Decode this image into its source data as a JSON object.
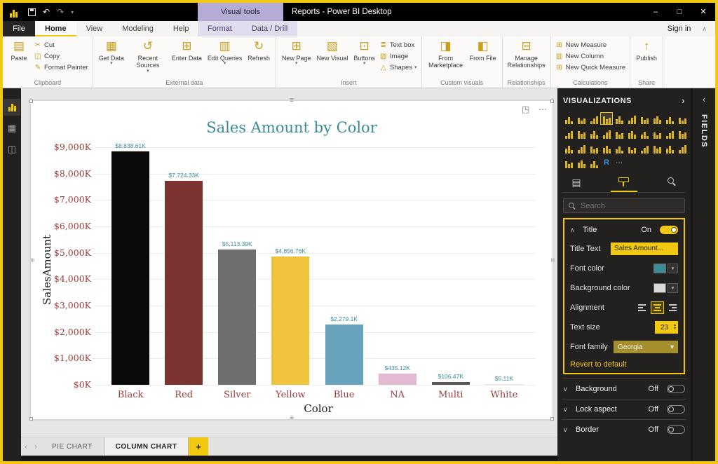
{
  "window": {
    "title": "Reports - Power BI Desktop",
    "undo_glyph": "↶",
    "redo_glyph": "↷",
    "controls": {
      "minimize": "–",
      "maximize": "□",
      "close": "✕"
    }
  },
  "icons": {
    "dropdown": "▾",
    "collapse_ribbon": "∧",
    "pane_collapse_right": "›",
    "pane_collapse_left": "‹",
    "page_back": "‹",
    "page_forward": "›",
    "focus_mode": "◳",
    "more_options": "⋯",
    "drag_handle": "≡"
  },
  "contextual": {
    "group_label": "Visual tools",
    "tabs": [
      "Format",
      "Data / Drill"
    ]
  },
  "ribbon_tabs": [
    "File",
    "Home",
    "View",
    "Modeling",
    "Help"
  ],
  "active_tab": "Home",
  "sign_in": "Sign in",
  "ribbon_groups": [
    {
      "label": "Clipboard",
      "items": [
        {
          "label": "Paste",
          "size": "big",
          "icon": "clipboard-paste",
          "glyph": "▤"
        },
        {
          "label": "Cut",
          "size": "small",
          "icon": "scissors",
          "glyph": "✂"
        },
        {
          "label": "Copy",
          "size": "small",
          "icon": "copy",
          "glyph": "◫"
        },
        {
          "label": "Format Painter",
          "size": "small",
          "icon": "format-painter",
          "glyph": "✎"
        }
      ]
    },
    {
      "label": "External data",
      "items": [
        {
          "label": "Get Data",
          "size": "big",
          "icon": "get-data",
          "glyph": "▦",
          "arrow": true
        },
        {
          "label": "Recent Sources",
          "size": "big",
          "icon": "recent-sources",
          "glyph": "↺",
          "arrow": true
        },
        {
          "label": "Enter Data",
          "size": "big",
          "icon": "enter-data",
          "glyph": "⊞"
        },
        {
          "label": "Edit Queries",
          "size": "big",
          "icon": "edit-queries",
          "glyph": "▥",
          "arrow": true
        },
        {
          "label": "Refresh",
          "size": "big",
          "icon": "refresh",
          "glyph": "↻"
        }
      ]
    },
    {
      "label": "Insert",
      "items": [
        {
          "label": "New Page",
          "size": "big",
          "icon": "new-page",
          "glyph": "⊞",
          "arrow": true
        },
        {
          "label": "New Visual",
          "size": "big",
          "icon": "new-visual",
          "glyph": "▧"
        },
        {
          "label": "Buttons",
          "size": "big",
          "icon": "buttons",
          "glyph": "⊡",
          "arrow": true
        },
        {
          "label": "Text box",
          "size": "small",
          "icon": "text-box",
          "glyph": "≣"
        },
        {
          "label": "Image",
          "size": "small",
          "icon": "image",
          "glyph": "▨"
        },
        {
          "label": "Shapes",
          "size": "small",
          "icon": "shapes",
          "glyph": "△",
          "arrow": true
        }
      ]
    },
    {
      "label": "Custom visuals",
      "items": [
        {
          "label": "From Marketplace",
          "size": "big",
          "icon": "from-marketplace",
          "glyph": "◨"
        },
        {
          "label": "From File",
          "size": "big",
          "icon": "from-file",
          "glyph": "◧"
        }
      ]
    },
    {
      "label": "Relationships",
      "items": [
        {
          "label": "Manage Relationships",
          "size": "big",
          "icon": "manage-relationships",
          "glyph": "⊟"
        }
      ]
    },
    {
      "label": "Calculations",
      "items": [
        {
          "label": "New Measure",
          "size": "small",
          "icon": "new-measure",
          "glyph": "⊞"
        },
        {
          "label": "New Column",
          "size": "small",
          "icon": "new-column",
          "glyph": "▥"
        },
        {
          "label": "New Quick Measure",
          "size": "small",
          "icon": "new-quick-measure",
          "glyph": "⊞"
        }
      ]
    },
    {
      "label": "Share",
      "items": [
        {
          "label": "Publish",
          "size": "big",
          "icon": "publish",
          "glyph": "↑"
        }
      ]
    }
  ],
  "chart_data": {
    "type": "bar",
    "title": "Sales Amount by Color",
    "xlabel": "Color",
    "ylabel": "SalesAmount",
    "categories": [
      "Black",
      "Red",
      "Silver",
      "Yellow",
      "Blue",
      "NA",
      "Multi",
      "White"
    ],
    "values": [
      8838.61,
      7724.33,
      5113.39,
      4856.76,
      2279.1,
      435.12,
      106.47,
      5.11
    ],
    "value_labels": [
      "$8,838.61K",
      "$7,724.33K",
      "$5,113.39K",
      "$4,856.76K",
      "$2,279.1K",
      "$435.12K",
      "$106.47K",
      "$5.11K"
    ],
    "ylim": [
      0,
      9000
    ],
    "yticks": [
      "$9,000K",
      "$8,000K",
      "$7,000K",
      "$6,000K",
      "$5,000K",
      "$4,000K",
      "$3,000K",
      "$2,000K",
      "$1,000K",
      "$0K"
    ],
    "bar_colors": [
      "#0A0A0A",
      "#7D3232",
      "#6F6F6F",
      "#EFC43C",
      "#69A2BD",
      "#E3BAD2",
      "#555555",
      "#E9E0DA"
    ],
    "gridlines": true,
    "legend": false,
    "title_color": "#3A8D96",
    "axis_label_color": "#9A3D3B"
  },
  "page_tabs": {
    "items": [
      "PIE CHART",
      "COLUMN CHART"
    ],
    "active": "COLUMN CHART",
    "add_label": "+"
  },
  "panels": {
    "visualizations_title": "VISUALIZATIONS",
    "fields_title": "FIELDS"
  },
  "visualizations": {
    "selected_index": 3,
    "visual_types": [
      "stacked-bar-chart",
      "stacked-column-chart",
      "clustered-bar-chart",
      "clustered-column-chart",
      "hundred-stacked-bar-chart",
      "hundred-stacked-column-chart",
      "line-chart",
      "area-chart",
      "stacked-area-chart",
      "line-and-stacked-column-chart",
      "line-and-clustered-column-chart",
      "ribbon-chart",
      "waterfall-chart",
      "scatter-chart",
      "pie-chart",
      "donut-chart",
      "treemap",
      "map",
      "filled-map",
      "shape-map",
      "funnel",
      "gauge",
      "card",
      "multi-row-card",
      "kpi",
      "slicer",
      "table",
      "matrix",
      "paginated-report",
      "arcgis-map",
      "python-visual",
      "power-apps",
      "key-influencers",
      "r-script-visual",
      "more-options"
    ]
  },
  "format_pane": {
    "search_placeholder": "Search",
    "title_card": {
      "chevron_glyph": "∧",
      "label": "Title",
      "state": "On",
      "title_text_label": "Title Text",
      "title_text_value": "Sales Amount...",
      "font_color_label": "Font color",
      "font_color_value": "#3A8D96",
      "background_color_label": "Background color",
      "background_color_value": "#D9D9D9",
      "alignment_label": "Alignment",
      "text_size_label": "Text size",
      "text_size_value": "23",
      "font_family_label": "Font family",
      "font_family_value": "Georgia",
      "revert_label": "Revert to default"
    },
    "cards": [
      {
        "chevron_glyph": "∨",
        "name": "Background",
        "state": "Off"
      },
      {
        "chevron_glyph": "∨",
        "name": "Lock aspect",
        "state": "Off"
      },
      {
        "chevron_glyph": "∨",
        "name": "Border",
        "state": "Off"
      }
    ]
  }
}
